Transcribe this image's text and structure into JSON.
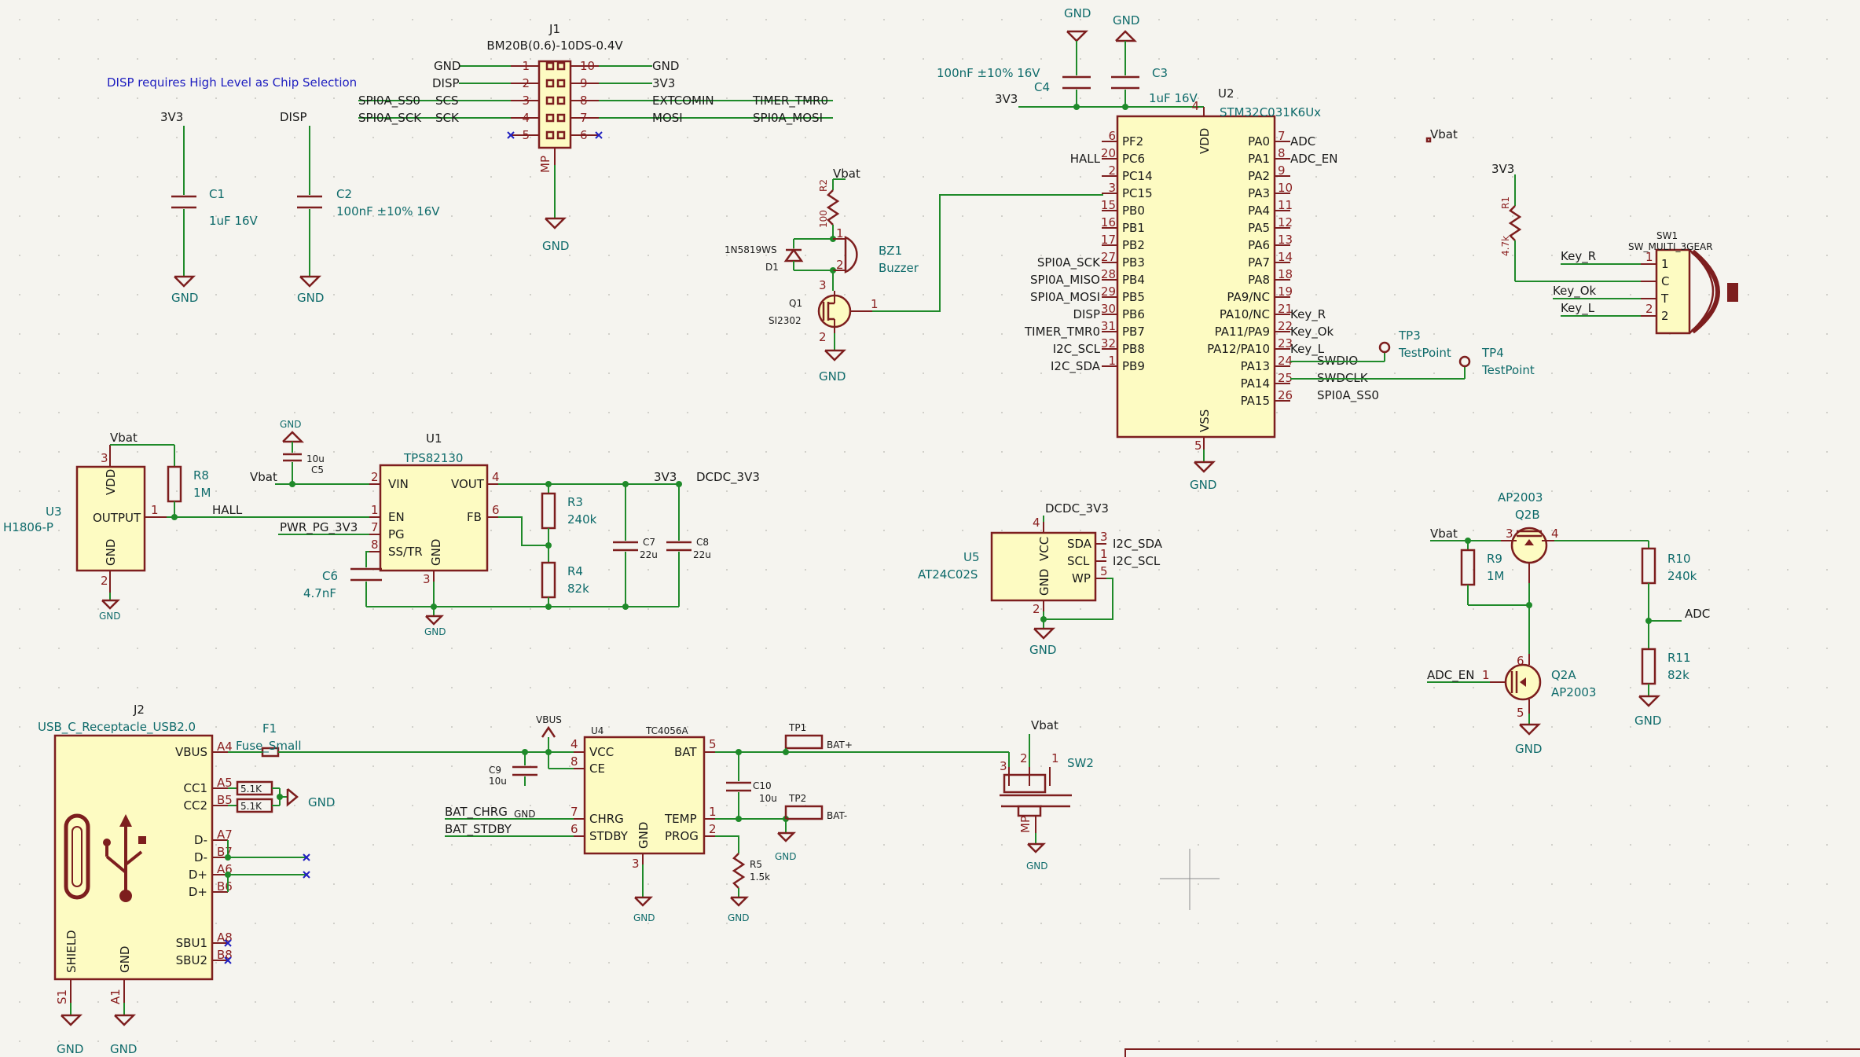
{
  "note": "DISP requires High Level as Chip Selection",
  "power": {
    "gnd": "GND",
    "v3v3": "3V3",
    "vbat": "Vbat",
    "vbus": "VBUS",
    "dcdc": "DCDC_3V3"
  },
  "nets": {
    "disp": "DISP",
    "spi_ss0": "SPI0A_SS0",
    "spi_sck": "SPI0A_SCK",
    "spi_mosi": "SPI0A_MOSI",
    "spi_miso": "SPI0A_MISO",
    "timer": "TIMER_TMR0",
    "hall": "HALL",
    "adc": "ADC",
    "adc_en": "ADC_EN",
    "key_r": "Key_R",
    "key_ok": "Key_Ok",
    "key_l": "Key_L",
    "swdio": "SWDIO",
    "swdclk": "SWDCLK",
    "i2c_scl": "I2C_SCL",
    "i2c_sda": "I2C_SDA",
    "pwr_pg": "PWR_PG_3V3",
    "bat_chrg": "BAT_CHRG",
    "bat_stdby": "BAT_STDBY",
    "bat_p": "BAT+",
    "bat_n": "BAT-"
  },
  "j1": {
    "ref": "J1",
    "value": "BM20B(0.6)-10DS-0.4V",
    "mp": "MP",
    "left_labels": [
      "GND",
      "DISP",
      "SPI0A_SS0",
      "SPI0A_SCK"
    ],
    "left_pins": [
      "1",
      "2",
      "3",
      "4",
      "5"
    ],
    "left_funcs": [
      "SCS",
      "SCK"
    ],
    "right_pins": [
      "10",
      "9",
      "8",
      "7",
      "6"
    ],
    "right_labels": [
      "GND",
      "3V3",
      "EXTCOMIN",
      "MOSI"
    ],
    "far_right": [
      "TIMER_TMR0",
      "SPI0A_MOSI"
    ]
  },
  "c1": {
    "ref": "C1",
    "value": "1uF 16V"
  },
  "c2": {
    "ref": "C2",
    "value": "100nF ±10% 16V"
  },
  "c3": {
    "ref": "C3",
    "value": "1uF 16V"
  },
  "c4": {
    "ref": "C4",
    "value": "100nF ±10% 16V"
  },
  "u2": {
    "ref": "U2",
    "value": "STM32C031K6Ux",
    "top_pin": {
      "name": "VDD",
      "num": "4"
    },
    "bottom_pin": {
      "name": "VSS",
      "num": "5"
    },
    "left": [
      {
        "name": "PF2",
        "num": "6",
        "net": ""
      },
      {
        "name": "PC6",
        "num": "20",
        "net": "HALL"
      },
      {
        "name": "PC14",
        "num": "2",
        "net": ""
      },
      {
        "name": "PC15",
        "num": "3",
        "net": ""
      },
      {
        "name": "PB0",
        "num": "15",
        "net": ""
      },
      {
        "name": "PB1",
        "num": "16",
        "net": ""
      },
      {
        "name": "PB2",
        "num": "17",
        "net": ""
      },
      {
        "name": "PB3",
        "num": "27",
        "net": "SPI0A_SCK"
      },
      {
        "name": "PB4",
        "num": "28",
        "net": "SPI0A_MISO"
      },
      {
        "name": "PB5",
        "num": "29",
        "net": "SPI0A_MOSI"
      },
      {
        "name": "PB6",
        "num": "30",
        "net": "DISP"
      },
      {
        "name": "PB7",
        "num": "31",
        "net": "TIMER_TMR0"
      },
      {
        "name": "PB8",
        "num": "32",
        "net": "I2C_SCL"
      },
      {
        "name": "PB9",
        "num": "1",
        "net": "I2C_SDA"
      }
    ],
    "right": [
      {
        "name": "PA0",
        "num": "7",
        "net": "ADC"
      },
      {
        "name": "PA1",
        "num": "8",
        "net": "ADC_EN"
      },
      {
        "name": "PA2",
        "num": "9",
        "net": ""
      },
      {
        "name": "PA3",
        "num": "10",
        "net": ""
      },
      {
        "name": "PA4",
        "num": "11",
        "net": ""
      },
      {
        "name": "PA5",
        "num": "12",
        "net": ""
      },
      {
        "name": "PA6",
        "num": "13",
        "net": ""
      },
      {
        "name": "PA7",
        "num": "14",
        "net": ""
      },
      {
        "name": "PA8",
        "num": "18",
        "net": ""
      },
      {
        "name": "PA9/NC",
        "num": "19",
        "net": ""
      },
      {
        "name": "PA10/NC",
        "num": "21",
        "net": "Key_R"
      },
      {
        "name": "PA11/PA9",
        "num": "22",
        "net": "Key_Ok"
      },
      {
        "name": "PA12/PA10",
        "num": "23",
        "net": "Key_L"
      },
      {
        "name": "PA13",
        "num": "24",
        "net": "SWDIO"
      },
      {
        "name": "PA14",
        "num": "25",
        "net": "SWDCLK"
      },
      {
        "name": "PA15",
        "num": "26",
        "net": "SPI0A_SS0"
      }
    ]
  },
  "tp3": {
    "ref": "TP3",
    "value": "TestPoint"
  },
  "tp4": {
    "ref": "TP4",
    "value": "TestPoint"
  },
  "r2": {
    "ref": "R2",
    "value": "100"
  },
  "d1": {
    "ref": "D1",
    "value": "1N5819WS"
  },
  "bz1": {
    "ref": "BZ1",
    "value": "Buzzer",
    "p1": "1",
    "p2": "2"
  },
  "q1": {
    "ref": "Q1",
    "value": "SI2302",
    "p1": "1",
    "p2": "2",
    "p3": "3"
  },
  "sw1": {
    "ref": "SW1",
    "value": "SW_MULTI_3GEAR",
    "pins": [
      "1",
      "C",
      "T",
      "2"
    ]
  },
  "r1": {
    "ref": "R1",
    "value": "4.7k"
  },
  "u3": {
    "ref": "U3",
    "value": "H1806-P",
    "vdd": "VDD",
    "out": "OUTPUT",
    "gnd": "GND",
    "p1": "1",
    "p2": "2",
    "p3": "3"
  },
  "r8": {
    "ref": "R8",
    "value": "1M"
  },
  "c5": {
    "ref": "C5",
    "value": "10u"
  },
  "u1": {
    "ref": "U1",
    "value": "TPS82130",
    "pins_l": [
      "VIN",
      "EN",
      "PG",
      "SS/TR"
    ],
    "nums_l": [
      "2",
      "1",
      "7",
      "8"
    ],
    "vout": "VOUT",
    "fb": "FB",
    "gnd": "GND",
    "n_vout": "4",
    "n_fb": "6",
    "n_gnd": "3"
  },
  "c6": {
    "ref": "C6",
    "value": "4.7nF"
  },
  "r3": {
    "ref": "R3",
    "value": "240k"
  },
  "r4": {
    "ref": "R4",
    "value": "82k"
  },
  "c7": {
    "ref": "C7",
    "value": "22u"
  },
  "c8": {
    "ref": "C8",
    "value": "22u"
  },
  "u5": {
    "ref": "U5",
    "value": "AT24C02S",
    "vcc": "VCC",
    "gnd": "GND",
    "sda": "SDA",
    "scl": "SCL",
    "wp": "WP",
    "n_vcc": "4",
    "n_gnd": "2",
    "n_sda": "3",
    "n_scl": "1",
    "n_wp": "5"
  },
  "q2b": {
    "ref": "Q2B",
    "value": "AP2003",
    "p3": "3",
    "p4": "4"
  },
  "q2a": {
    "ref": "Q2A",
    "value": "AP2003",
    "p1": "1",
    "p6": "6",
    "p5": "5"
  },
  "r9": {
    "ref": "R9",
    "value": "1M"
  },
  "r10": {
    "ref": "R10",
    "value": "240k"
  },
  "r11": {
    "ref": "R11",
    "value": "82k"
  },
  "j2": {
    "ref": "J2",
    "value": "USB_C_Receptacle_USB2.0",
    "pins": [
      "VBUS",
      "CC1",
      "CC2",
      "D-",
      "D-",
      "D+",
      "D+",
      "SBU1",
      "SBU2"
    ],
    "nums": [
      "A4",
      "A5",
      "B5",
      "A7",
      "B7",
      "A6",
      "B6",
      "A8",
      "B8"
    ],
    "shield": "SHIELD",
    "gnd": "GND",
    "s1": "S1",
    "a1": "A1"
  },
  "f1": {
    "ref": "F1",
    "value": "Fuse_Small"
  },
  "r_cc": {
    "value": "5.1K"
  },
  "u4": {
    "ref": "U4",
    "value": "TC4056A",
    "vcc": "VCC",
    "ce": "CE",
    "bat": "BAT",
    "chrg": "CHRG",
    "stdby": "STDBY",
    "gnd": "GND",
    "temp": "TEMP",
    "prog": "PROG",
    "n_vcc": "4",
    "n_ce": "8",
    "n_bat": "5",
    "n_chrg": "7",
    "n_stdby": "6",
    "n_gnd": "3",
    "n_temp": "1",
    "n_prog": "2"
  },
  "c9": {
    "ref": "C9",
    "value": "10u"
  },
  "c10": {
    "ref": "C10",
    "value": "10u"
  },
  "r5": {
    "ref": "R5",
    "value": "1.5k"
  },
  "tp1": {
    "ref": "TP1"
  },
  "tp2": {
    "ref": "TP2"
  },
  "sw2": {
    "ref": "SW2",
    "p1": "1",
    "p2": "2",
    "p3": "3",
    "mp": "MP"
  }
}
